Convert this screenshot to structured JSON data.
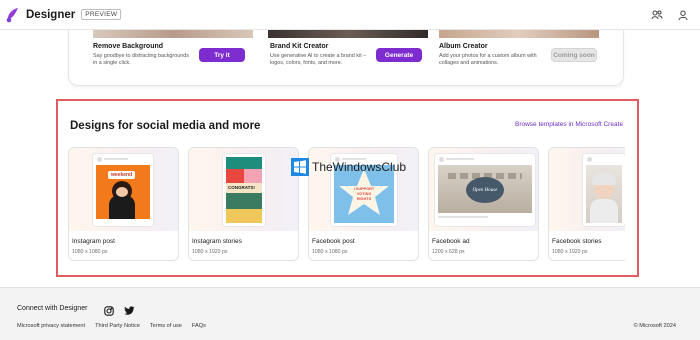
{
  "header": {
    "app_name": "Designer",
    "badge": "PREVIEW",
    "icons": [
      "designer-logo-icon",
      "share-people-icon",
      "account-icon"
    ]
  },
  "features": [
    {
      "title": "Remove Background",
      "description": "Say goodbye to distracting backgrounds in a single click.",
      "button": "Try it",
      "button_state": "enabled"
    },
    {
      "title": "Brand Kit Creator",
      "description": "Use generative AI to create a brand kit – logos, colors, fonts, and more.",
      "button": "Generate",
      "button_state": "enabled"
    },
    {
      "title": "Album Creator",
      "description": "Add your photos for a custom album with collages and animations.",
      "button": "Coming soon",
      "button_state": "disabled"
    }
  ],
  "social": {
    "title": "Designs for social media and more",
    "browse_link": "Browse templates in Microsoft Create",
    "templates": [
      {
        "name": "Instagram post",
        "size": "1080 x 1080 px",
        "thumb_text": "weekend"
      },
      {
        "name": "Instagram stories",
        "size": "1080 x 1920 px",
        "thumb_text": "CONGRATS!"
      },
      {
        "name": "Facebook post",
        "size": "1080 x 1080 px",
        "thumb_text": "I SUPPORT VOTING RIGHTS"
      },
      {
        "name": "Facebook ad",
        "size": "1200 x 628 px",
        "thumb_text": "Open House"
      },
      {
        "name": "Facebook stories",
        "size": "1080 x 1920 px",
        "thumb_text": ""
      }
    ]
  },
  "watermark": {
    "text": "TheWindowsClub"
  },
  "footer": {
    "connect": "Connect with Designer",
    "links": [
      "Microsoft privacy statement",
      "Third Party Notice",
      "Terms of use",
      "FAQs"
    ],
    "copyright": "© Microsoft 2024"
  },
  "colors": {
    "accent": "#7c2ccf",
    "link": "#6b2fc7",
    "highlight_border": "#e15b61"
  }
}
